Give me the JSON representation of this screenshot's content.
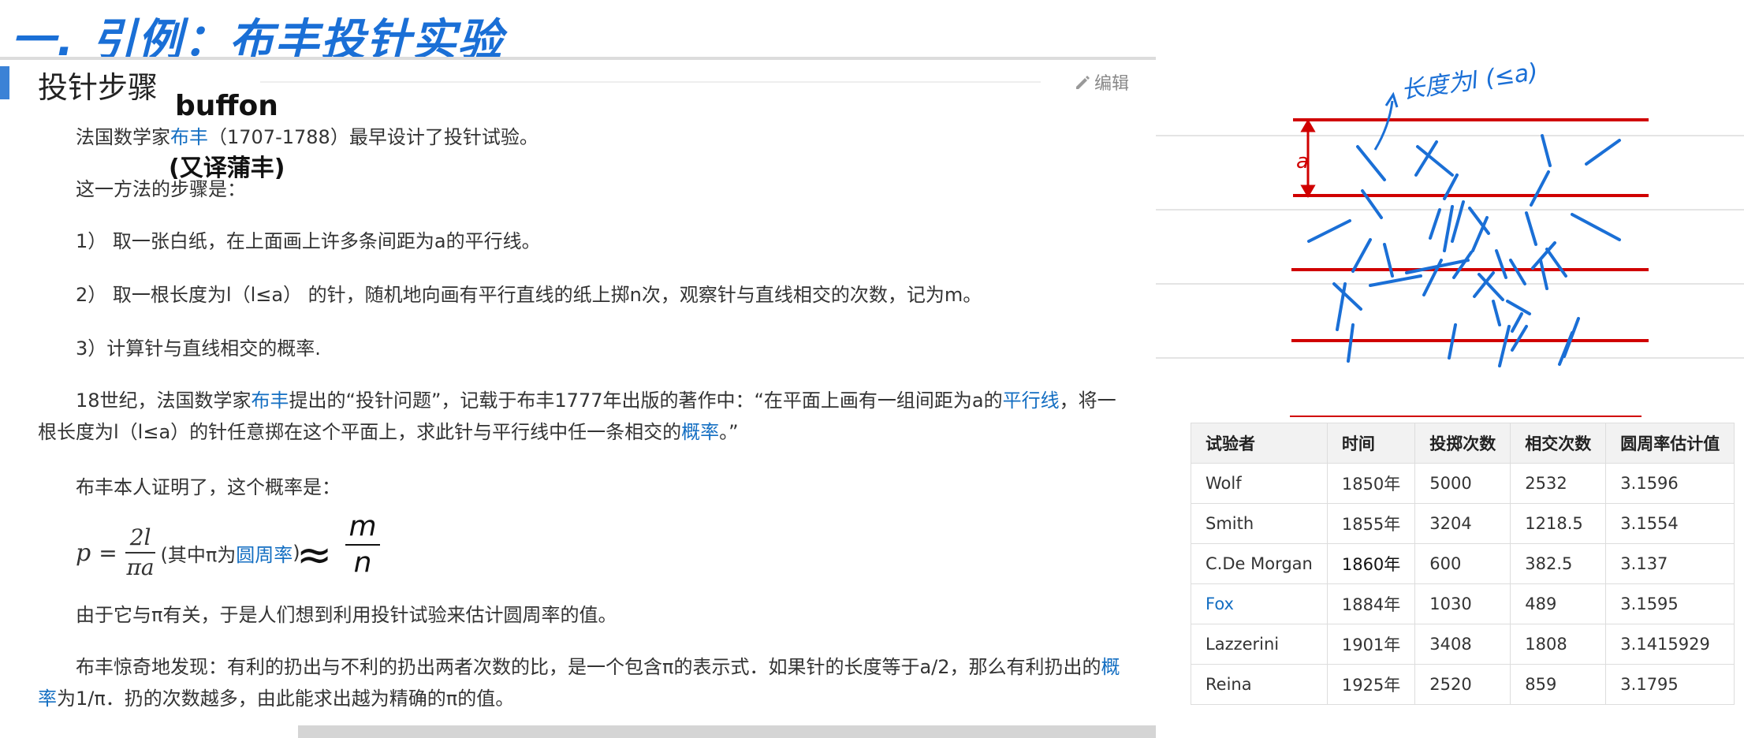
{
  "annotations": {
    "top_title": "一. 引例：布丰投针实验",
    "buffon_note": "buffon",
    "alias_note": "(又译蒲丰)",
    "approx_symbol": "≈",
    "approx_num": "m",
    "approx_den": "n",
    "length_note": "长度为l (≤a)",
    "spacing_label": "a"
  },
  "article": {
    "section_title": "投针步骤",
    "edit_label": "编辑",
    "p1": {
      "pre": "法国数学家",
      "link": "布丰",
      "post": "（1707-1788）最早设计了投针试验。"
    },
    "p2": "这一方法的步骤是：",
    "step1": "1） 取一张白纸，在上面画上许多条间距为a的平行线。",
    "step2": "2） 取一根长度为l（l≤a） 的针，随机地向画有平行直线的纸上掷n次，观察针与直线相交的次数，记为m。",
    "step3": "3）计算针与直线相交的概率.",
    "p3": {
      "a": "18世纪，法国数学家",
      "link1": "布丰",
      "b": "提出的“投针问题”，记载于布丰1777年出版的著作中：“在平面上画有一组间距为a的",
      "link2": "平行线",
      "c": "，将一根长度为l（l≤a）的针任意掷在这个平面上，求此针与平行线中任一条相交的",
      "link3": "概率",
      "d": "。”"
    },
    "p4": "布丰本人证明了，这个概率是：",
    "formula": {
      "lhs": "p",
      "eq": "=",
      "num": "2l",
      "den": "πa",
      "paren_pre": "(其中π为",
      "link": "圆周率",
      "paren_post": ")"
    },
    "p5": "由于它与π有关，于是人们想到利用投针试验来估计圆周率的值。",
    "p6": {
      "a": "布丰惊奇地发现：有利的扔出与不利的扔出两者次数的比，是一个包含π的表示式．如果针的长度等于a/2，那么有利扔出的",
      "link": "概率",
      "b": "为1/π．扔的次数越多，由此能求出越为精确的π的值。"
    }
  },
  "table": {
    "headers": [
      "试验者",
      "时间",
      "投掷次数",
      "相交次数",
      "圆周率估计值"
    ],
    "rows": [
      [
        "Wolf",
        "1850年",
        "5000",
        "2532",
        "3.1596"
      ],
      [
        "Smith",
        "1855年",
        "3204",
        "1218.5",
        "3.1554"
      ],
      [
        "C.De Morgan",
        "1860年",
        "600",
        "382.5",
        "3.137"
      ],
      [
        "Fox",
        "1884年",
        "1030",
        "489",
        "3.1595"
      ],
      [
        "Lazzerini",
        "1901年",
        "3408",
        "1808",
        "3.1415929"
      ],
      [
        "Reina",
        "1925年",
        "2520",
        "859",
        "3.1795"
      ]
    ]
  },
  "colors": {
    "link": "#136ec2",
    "handwriting": "#1a6fd6",
    "parallel_line": "#d00000",
    "needle": "#1a6fd6"
  }
}
